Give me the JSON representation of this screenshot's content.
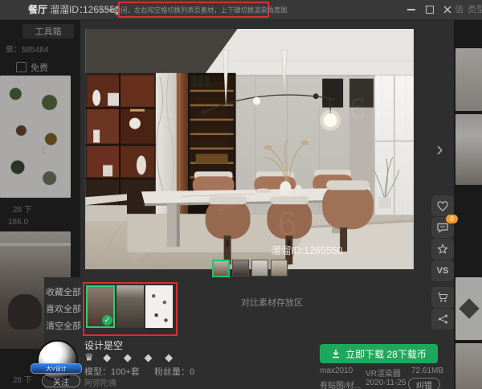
{
  "window": {
    "title_room": "餐厅",
    "title_id_label": "溜溜ID：",
    "title_id_value": "1265550",
    "hint_text": "ESC关闭，左右和空格切换列表页素材，上下键切换渲染角度图",
    "bg_fragment_1": "值",
    "bg_fragment_2": "类型"
  },
  "left_panel": {
    "toolbox": "工具箱",
    "results": "果：585484",
    "free_label": "免费",
    "meta_1": "28 下",
    "meta_2": "186.0",
    "meta_3": "28 下"
  },
  "viewer": {
    "watermark_id": "溜溜ID:1265550",
    "watermark_site": "3d66.com",
    "watermark_glyph": "6",
    "prev_arrow": "‹",
    "next_arrow": "›"
  },
  "compare_bar": {
    "collect_all": "收藏全部",
    "like_all": "喜欢全部",
    "clear_all": "清空全部",
    "storage_label": "对比素材存放区",
    "selected_check": "✓"
  },
  "right_toolbar": {
    "comment_badge": "0",
    "vs": "VS"
  },
  "designer": {
    "name": "设计是空",
    "badge": "大V设计",
    "follow": "关注",
    "crown": "♛",
    "diamonds": "◆ ◆ ◆ ◆",
    "models": "模型：100+套",
    "fans": "粉丝量：0",
    "signature": "阿弥陀佛"
  },
  "download": {
    "button_label": "立即下载 28下载币",
    "format": "max2010",
    "renderer": "VR渲染器",
    "filesize": "72.61MB",
    "maps": "有贴图/材...",
    "date": "2020-11-25",
    "report": "纠错"
  },
  "colors": {
    "accent_green": "#1ea85c",
    "annotation_red": "#d43030",
    "badge_orange": "#f59a23",
    "selected_green": "#2ecc71"
  }
}
